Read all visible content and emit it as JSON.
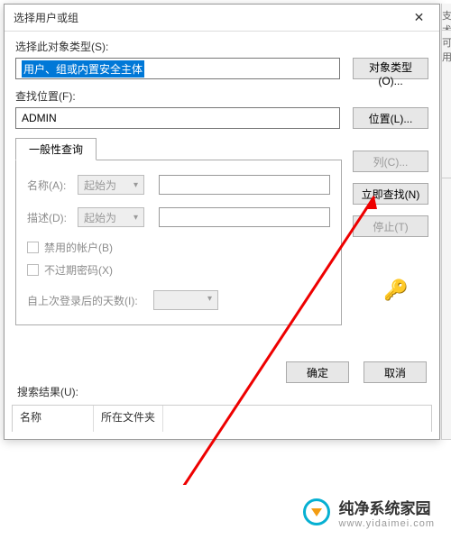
{
  "dialog": {
    "title": "选择用户或组",
    "obj_type_label": "选择此对象类型(S):",
    "obj_type_value": "用户、组或内置安全主体",
    "obj_type_btn": "对象类型(O)...",
    "location_label": "查找位置(F):",
    "location_value": "ADMIN",
    "location_btn": "位置(L)...",
    "tab_label": "一般性查询",
    "name_label": "名称(A):",
    "name_select": "起始为",
    "name_value": "",
    "desc_label": "描述(D):",
    "desc_select": "起始为",
    "desc_value": "",
    "chk_disabled": "禁用的帐户(B)",
    "chk_noexpire": "不过期密码(X)",
    "days_label": "自上次登录后的天数(I):",
    "days_value": "",
    "columns_btn": "列(C)...",
    "find_now_btn": "立即查找(N)",
    "stop_btn": "停止(T)",
    "ok_btn": "确定",
    "cancel_btn": "取消",
    "results_label": "搜索结果(U):",
    "col_name": "名称",
    "col_folder": "所在文件夹"
  },
  "banner": {
    "title": "纯净系统家园",
    "url": "www.yidaimei.com"
  },
  "right_panel": {
    "cell1": "支术",
    "cell2": "可用"
  }
}
